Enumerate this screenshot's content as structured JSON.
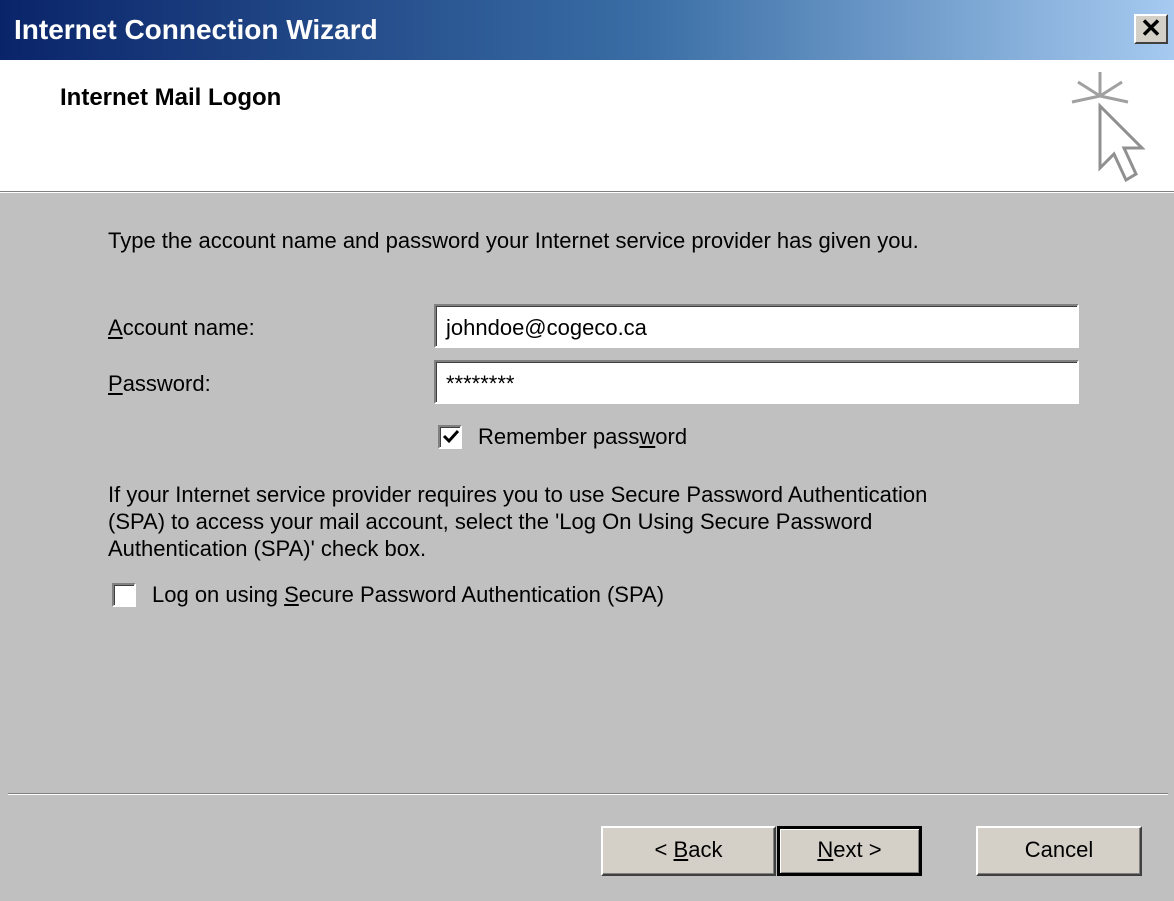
{
  "window": {
    "title": "Internet Connection Wizard",
    "close_glyph": "✕"
  },
  "header": {
    "title": "Internet Mail Logon",
    "icon": "wizard-cursor-icon"
  },
  "instructions": "Type the account name and password your Internet service provider has given you.",
  "account": {
    "label_key": "A",
    "label_rest": "ccount name:",
    "value": "johndoe@cogeco.ca"
  },
  "password": {
    "label_key": "P",
    "label_rest": "assword:",
    "value": "********"
  },
  "remember": {
    "label_pre": "Remember pass",
    "label_key": "w",
    "label_post": "ord",
    "checked": true
  },
  "spa_text": {
    "line1": "If your Internet service provider requires you to use Secure Password Authentication",
    "line2": "(SPA) to access your mail account, select the 'Log On Using Secure Password",
    "line3": "Authentication (SPA)' check box."
  },
  "spa_checkbox": {
    "label_pre": "Log on using ",
    "label_key": "S",
    "label_post": "ecure Password Authentication (SPA)",
    "checked": false
  },
  "buttons": {
    "back_pre": "< ",
    "back_key": "B",
    "back_post": "ack",
    "next_key": "N",
    "next_post": "ext >",
    "cancel": "Cancel"
  }
}
